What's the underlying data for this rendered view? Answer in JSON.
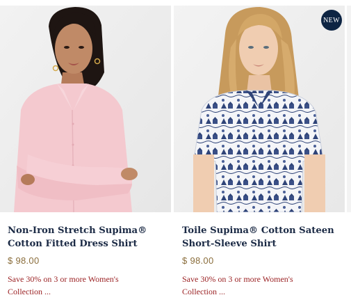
{
  "products": [
    {
      "title": "Non-Iron Stretch Supima® Cotton Fitted Dress Shirt",
      "price": "$ 98.00",
      "promo": "Save 30% on 3 or more Women's Collection ...",
      "image_alt": "Woman in pink fitted dress shirt with arms crossed"
    },
    {
      "title": "Toile Supima® Cotton Sateen Short-Sleeve Shirt",
      "price": "$ 98.00",
      "promo": "Save 30% on 3 or more Women's Collection ...",
      "badge": "NEW",
      "image_alt": "Woman in navy and white toile print short-sleeve shirt"
    }
  ],
  "colors": {
    "title": "#1b2a45",
    "price": "#8a6d3b",
    "promo": "#9b2224",
    "badge": "#0d2443",
    "shirt_pink": "#f4c9cf",
    "toile_navy": "#2f4478"
  }
}
